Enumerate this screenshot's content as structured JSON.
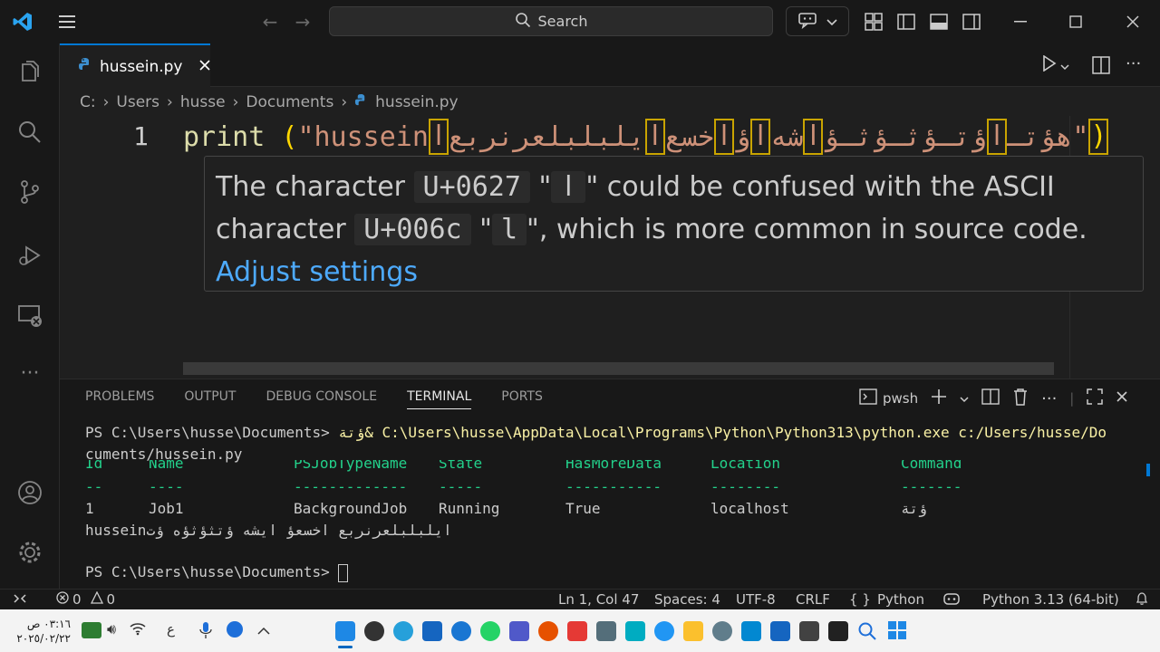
{
  "titlebar": {
    "search_label": "Search",
    "icons": [
      "vscode-logo-icon",
      "menu-icon",
      "back-arrow-icon",
      "forward-arrow-icon",
      "search-icon",
      "copilot-icon",
      "chevron-down-icon",
      "layout-customize-icon",
      "toggle-sidebar-icon",
      "toggle-panel-icon",
      "toggle-secondary-sidebar-icon",
      "minimize-icon",
      "maximize-icon",
      "close-icon"
    ]
  },
  "activitybar": {
    "items": [
      "explorer-icon",
      "search-icon",
      "source-control-icon",
      "run-debug-icon",
      "remote-explorer-icon",
      "more-icon",
      "account-icon",
      "settings-gear-icon"
    ]
  },
  "tab": {
    "filename": "hussein.py"
  },
  "breadcrumb": {
    "items": [
      "C:",
      "Users",
      "husse",
      "Documents",
      "hussein.py"
    ]
  },
  "editor": {
    "line_number": "1",
    "code": {
      "keyword": "print",
      "space": " ",
      "open_paren": "(",
      "open_quote": "\"",
      "str_start": "hussein",
      "seg1": "ا",
      "seg2": "يلبلبلعرنربع",
      "seg3": "ا",
      "seg4": "خسع",
      "seg5": "ا",
      "seg6": "ؤ",
      "seg7": "ا",
      "seg8": "شه",
      "seg9": "ا",
      "seg10": "ؤتـؤثـؤثـؤ",
      "seg11": "ا",
      "seg12": "هؤتـ",
      "close_quote": "\"",
      "close_paren": ")"
    },
    "hover": {
      "text1": "The character",
      "code1": "U+0627",
      "q1": "\"",
      "char1": "ا",
      "q2": "\"",
      "text2": "could be confused with the ASCII character",
      "code2": "U+006c",
      "q3": "\"",
      "char2": "l",
      "q4": "\"",
      "text3": ", which is more common in source code.",
      "link": "Adjust settings"
    }
  },
  "panel": {
    "tabs": [
      "PROBLEMS",
      "OUTPUT",
      "DEBUG CONSOLE",
      "TERMINAL",
      "PORTS"
    ],
    "active_tab": "TERMINAL",
    "shell_label": "pwsh",
    "terminal": {
      "line1_prompt": "PS C:\\Users\\husse\\Documents> ",
      "line1_arabic": "ؤتة",
      "line1_cmd": "& C:\\Users\\husse\\AppData\\Local\\Programs\\Python\\Python313\\python.exe c:/Users/husse/Do",
      "line2": "cuments/hussein.py",
      "headers": [
        "Id",
        "Name",
        "PSJobTypeName",
        "State",
        "HasMoreData",
        "Location",
        "Command"
      ],
      "dashes": [
        "--",
        "----",
        "-------------",
        "-----",
        "-----------",
        "--------",
        "-------"
      ],
      "row": [
        "1",
        "Job1",
        "BackgroundJob",
        "Running",
        "True",
        "localhost",
        "ؤتة"
      ],
      "output": "husseinایلبلبلعرنربع اخسعؤ ايشه ؤتثؤثؤه ؤت",
      "prompt": "PS C:\\Users\\husse\\Documents> "
    }
  },
  "statusbar": {
    "errors": "0",
    "warnings": "0",
    "position": "Ln 1, Col 47",
    "spaces": "Spaces: 4",
    "encoding": "UTF-8",
    "eol": "CRLF",
    "language_brace": "{ }",
    "language": "Python",
    "interpreter": "Python 3.13 (64-bit)"
  },
  "taskbar": {
    "time": "٠٣:١٦ ص",
    "date": "٢٠٢٥/٠٢/٢٢",
    "lang": "ع",
    "apps": [
      "vscode-app-icon",
      "chrome-app-icon",
      "edge-app-icon",
      "store-app-icon",
      "edge-browser-icon",
      "whatsapp-icon",
      "teams-icon",
      "app-icon-8",
      "app-icon-9",
      "app-icon-10",
      "vpn-icon",
      "files-icon",
      "settings-app-icon",
      "photos-app-icon",
      "mail-app-icon",
      "camera-app-icon",
      "terminal-app-icon",
      "search-app-icon",
      "start-icon"
    ]
  }
}
